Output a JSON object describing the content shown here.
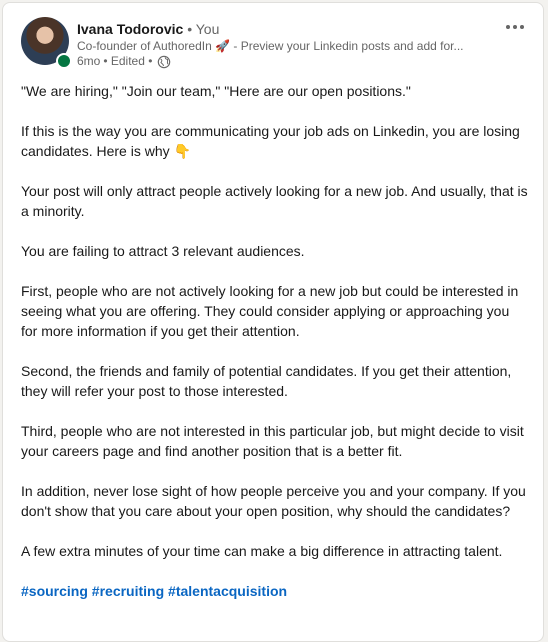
{
  "post": {
    "author": {
      "name": "Ivana Todorovic",
      "degree": "• You",
      "headline": "Co-founder of AuthoredIn 🚀 - Preview your Linkedin posts and add for...",
      "time": "6mo",
      "edited": "• Edited •",
      "presence_color": "#057642"
    },
    "visibility_icon": "globe-icon",
    "more_icon": "more-options-icon",
    "paragraphs": [
      "\"We are hiring,\" \"Join our team,\" \"Here are our open positions.\"",
      "If this is the way you are communicating your job ads on Linkedin, you are losing candidates. Here is why 👇",
      "Your post will only attract people actively looking for a new job. And usually, that is a minority.",
      "You are failing to attract 3 relevant audiences.",
      "First, people who are not actively looking for a new job but could be interested in seeing what you are offering. They could consider applying or approaching you for more information if you get their attention.",
      "Second, the friends and family of potential candidates. If you get their attention, they will refer your post to those interested.",
      "Third, people who are not interested in this particular job, but might decide to visit your careers page and find another position that is a better fit.",
      "In addition, never lose sight of how people perceive you and your company. If you don't show that you care about your open position, why should the candidates?",
      "A few extra minutes of your time can make a big difference in attracting talent."
    ],
    "hashtags": [
      "#sourcing",
      "#recruiting",
      "#talentacquisition"
    ],
    "link_color": "#0a66c2"
  }
}
